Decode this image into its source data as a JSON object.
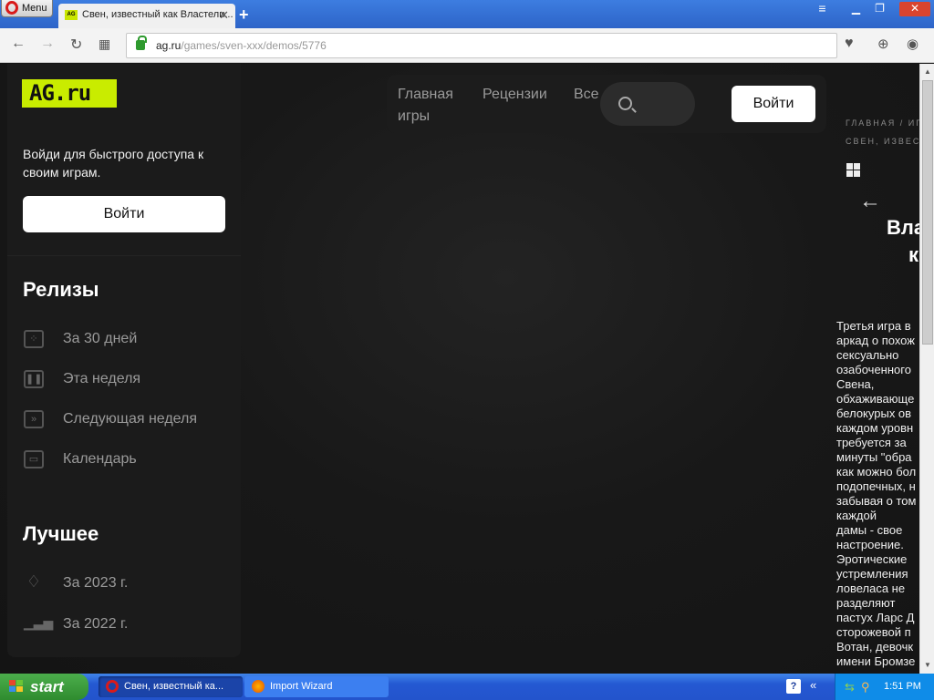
{
  "browser": {
    "menu_label": "Menu",
    "tab_title": "Свен, известный как Властели...",
    "tab_favicon_text": "AG",
    "tab_close": "✕",
    "new_tab": "+",
    "url_host": "ag.ru",
    "url_path": "/games/sven-xxx/demos/5776"
  },
  "site": {
    "logo_text": "AG.ru",
    "sidebar_prompt": "Войди для быстрого доступа к своим играм.",
    "sidebar_login": "Войти",
    "releases_title": "Релизы",
    "releases": [
      {
        "label": "За 30 дней",
        "icon": "calendar-dots-icon"
      },
      {
        "label": "Эта неделя",
        "icon": "pause-icon"
      },
      {
        "label": "Следующая неделя",
        "icon": "fast-forward-icon"
      },
      {
        "label": "Календарь",
        "icon": "calendar-icon"
      }
    ],
    "best_title": "Лучшее",
    "best": [
      {
        "label": "За 2023 г.",
        "icon": "diamond-icon"
      },
      {
        "label": "За 2022 г.",
        "icon": "bar-chart-icon"
      }
    ],
    "topnav": {
      "home_line1": "Главная",
      "home_line2": "игры",
      "reviews": "Рецензии",
      "all": "Все",
      "login": "Войти"
    },
    "breadcrumb_line1": "ГЛАВНАЯ / ИГ",
    "breadcrumb_line2": "СВЕН, ИЗВЕС",
    "back_arrow": "←",
    "game_title_line1": "Вла",
    "game_title_line2": "к",
    "description_lines": [
      "Третья игра в",
      "аркад о похож",
      "сексуально",
      "озабоченного",
      "Свена,",
      "обхаживающе",
      "белокурых ов",
      "каждом уровн",
      "требуется за",
      "минуты \"обра",
      "как можно бол",
      "подопечных, н",
      "забывая о том",
      "каждой",
      "дамы - свое",
      "настроение.",
      "Эротические",
      "устремления",
      "ловеласа не",
      "разделяют",
      "пастух Ларс Д",
      "сторожевой п",
      "Вотан, девочк",
      "имени Бромзе"
    ]
  },
  "taskbar": {
    "start": "start",
    "items": [
      "Свен, известный ка...",
      "Import Wizard"
    ],
    "clock": "1:51 PM"
  },
  "colors": {
    "accent": "#c9ec00",
    "page_bg": "#151515",
    "xp_blue": "#2458d2"
  }
}
